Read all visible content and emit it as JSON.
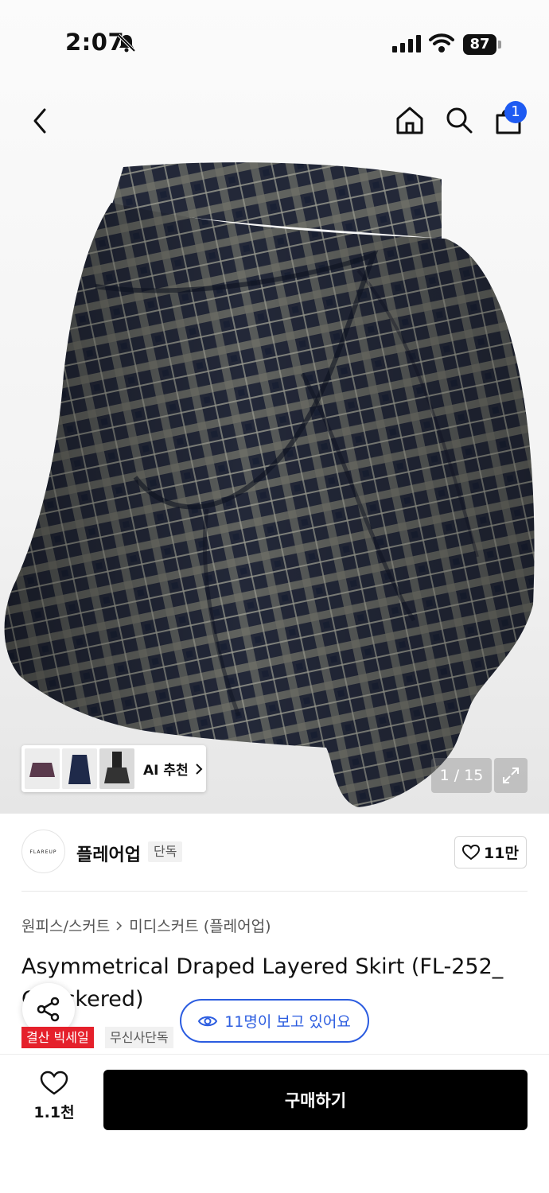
{
  "status_bar": {
    "time": "2:07",
    "battery": "87",
    "icons": [
      "bell-off-icon",
      "cellular-signal-icon",
      "wifi-icon",
      "battery-icon"
    ]
  },
  "nav": {
    "icons": [
      "back-chevron-icon",
      "home-icon",
      "search-icon",
      "shopping-bag-icon"
    ],
    "cart_count": "1"
  },
  "gallery": {
    "ai_label": "AI 추천",
    "counter": "1 / 15",
    "colors": {
      "plaid_dark": "#232838",
      "plaid_light": "#7b7d72"
    }
  },
  "brand": {
    "logo_text": "FLAREUP",
    "name": "플레어업",
    "tag": "단독",
    "likes": "11만"
  },
  "product": {
    "breadcrumb": [
      "원피스/스커트",
      "미디스커트 (플레어업)"
    ],
    "title": "Asymmetrical Draped Layered Skirt (FL-252_ Checkered)",
    "viewers": "11명이 보고 있어요",
    "tags": [
      "결산 빅세일",
      "무신사단독"
    ]
  },
  "bottom_bar": {
    "wish_count": "1.1천",
    "buy_label": "구매하기",
    "accent": "#2b5ce0",
    "sale_red": "#e5202b"
  }
}
